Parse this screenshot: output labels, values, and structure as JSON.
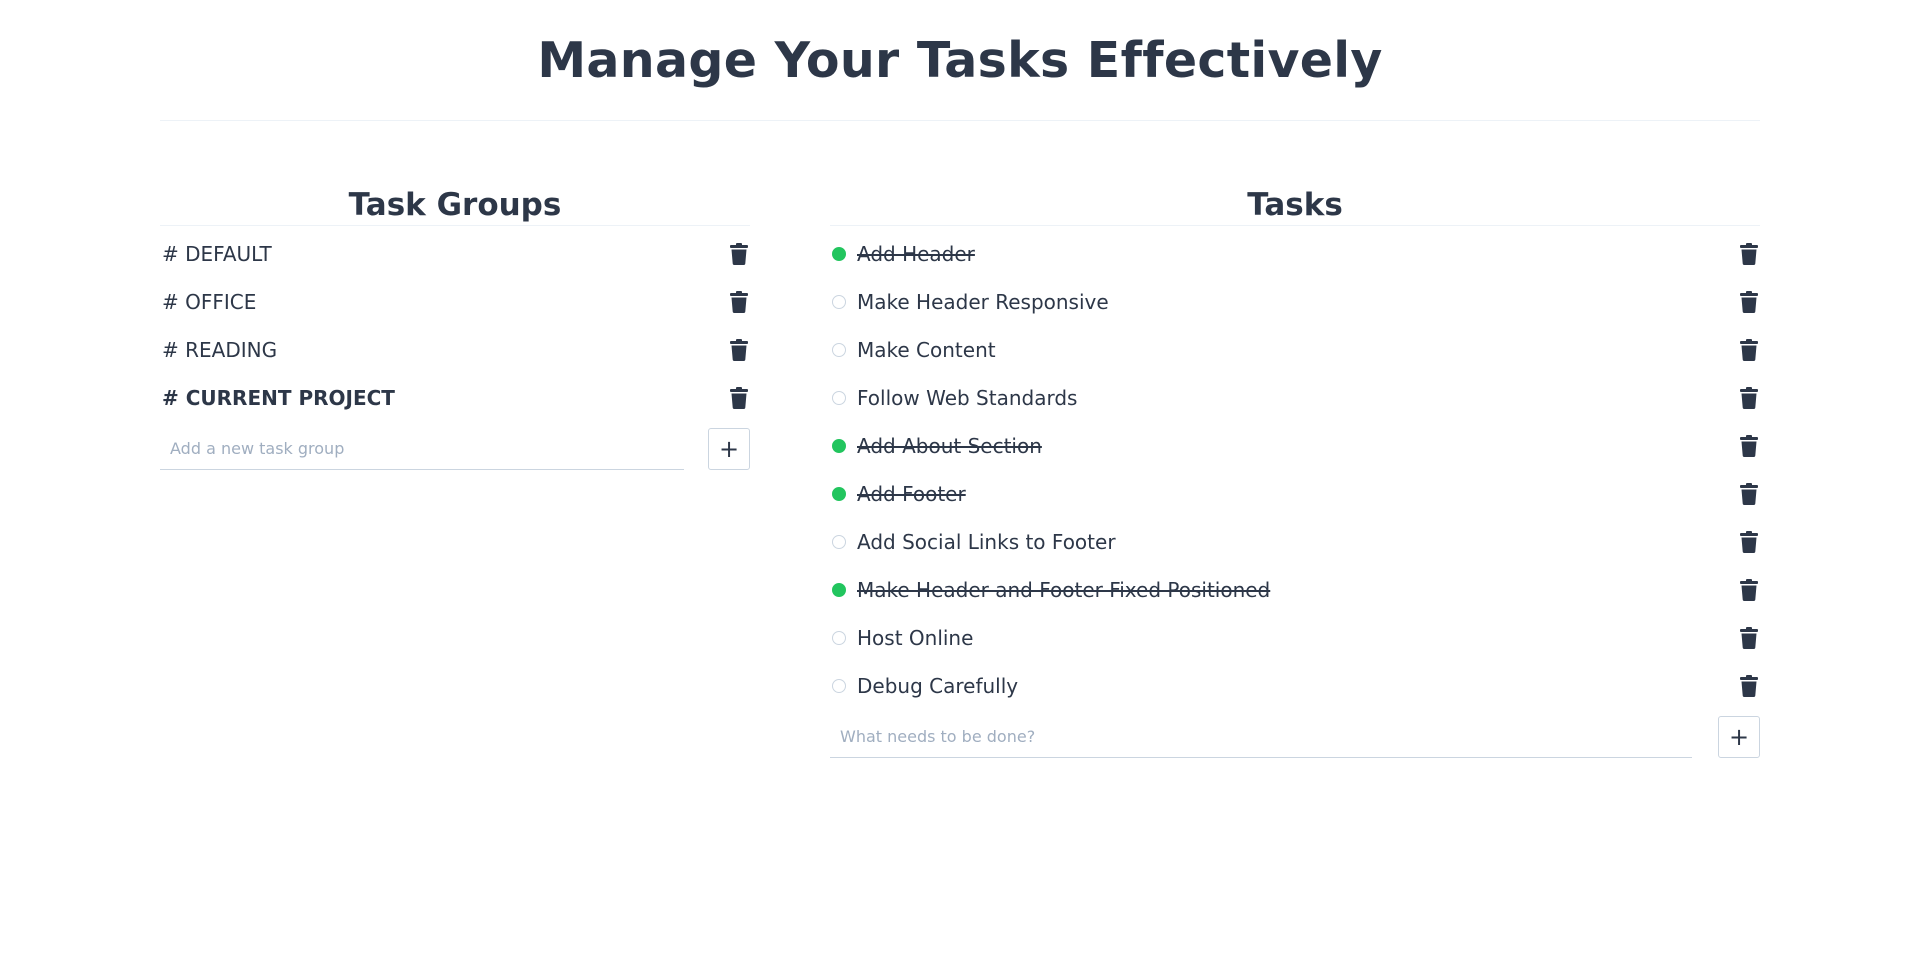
{
  "page": {
    "title": "Manage Your Tasks Effectively"
  },
  "groups": {
    "title": "Task Groups",
    "items": [
      {
        "label": "# DEFAULT",
        "active": false
      },
      {
        "label": "# OFFICE",
        "active": false
      },
      {
        "label": "# READING",
        "active": false
      },
      {
        "label": "# CURRENT PROJECT",
        "active": true
      }
    ],
    "input_placeholder": "Add a new task group",
    "add_label": "+"
  },
  "tasks": {
    "title": "Tasks",
    "items": [
      {
        "label": "Add Header",
        "done": true
      },
      {
        "label": "Make Header Responsive",
        "done": false
      },
      {
        "label": "Make Content",
        "done": false
      },
      {
        "label": "Follow Web Standards",
        "done": false
      },
      {
        "label": "Add About Section",
        "done": true
      },
      {
        "label": "Add Footer",
        "done": true
      },
      {
        "label": "Add Social Links to Footer",
        "done": false
      },
      {
        "label": "Make Header and Footer Fixed Positioned",
        "done": true
      },
      {
        "label": "Host Online",
        "done": false
      },
      {
        "label": "Debug Carefully",
        "done": false
      }
    ],
    "input_placeholder": "What needs to be done?",
    "add_label": "+"
  },
  "colors": {
    "text": "#2d3748",
    "done": "#22c55e",
    "border": "#cbd5e0"
  },
  "icons": {
    "delete": "trash-icon",
    "add": "plus-icon",
    "complete": "circle-check-icon"
  }
}
